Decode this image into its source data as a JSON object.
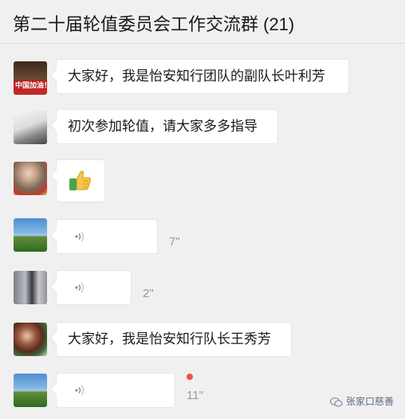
{
  "header": {
    "title": "第二十届轮值委员会工作交流群 (21)"
  },
  "messages": [
    {
      "type": "text",
      "text": "大家好，我是怡安知行团队的副队长叶利芳",
      "avatar_badge": "中国加油！"
    },
    {
      "type": "text",
      "text": "初次参加轮值，请大家多多指导"
    },
    {
      "type": "emoji",
      "emoji": "👍",
      "icon": "thumbs-up-emoji"
    },
    {
      "type": "voice",
      "duration": "7\""
    },
    {
      "type": "voice",
      "duration": "2\""
    },
    {
      "type": "text",
      "text": "大家好，我是怡安知行队长王秀芳"
    },
    {
      "type": "voice",
      "duration": "11\"",
      "unread": true
    }
  ],
  "watermark": {
    "text": "张家口慈善"
  },
  "colors": {
    "background": "#f0f0f0",
    "bubble": "#ffffff",
    "unread_dot": "#f25046",
    "muted_text": "#9a9a9a"
  }
}
